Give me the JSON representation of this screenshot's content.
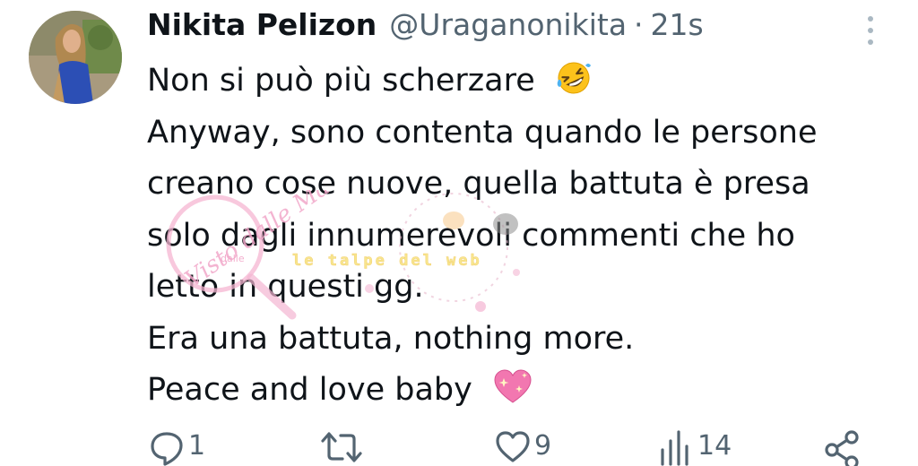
{
  "tweet": {
    "author_name": "Nikita Pelizon",
    "author_handle": "@Uraganonikita",
    "separator": "·",
    "timestamp": "21s",
    "lines": [
      "Non si può più scherzare",
      "Anyway, sono contenta quando le persone",
      "creano cose nuove, quella battuta è presa",
      "solo dagli innumerevoli commenti che ho",
      "letto in questi gg.",
      "Era una battuta, nothing more.",
      "Peace and love baby"
    ],
    "emojis": [
      "rolling-on-floor-laughing-emoji",
      "sparkling-heart-emoji"
    ]
  },
  "watermark": {
    "script_text": "Visto dalle Mars",
    "small_text": "dalle",
    "banner_text": "le talpe del web"
  },
  "actions": {
    "reply_count": "1",
    "retweet_count": "",
    "like_count": "9",
    "views_count": "14"
  },
  "colors": {
    "text": "#0f1419",
    "secondary": "#536471",
    "watermark_pink": "#f2a7c9",
    "watermark_yellow": "#f7e27a"
  }
}
